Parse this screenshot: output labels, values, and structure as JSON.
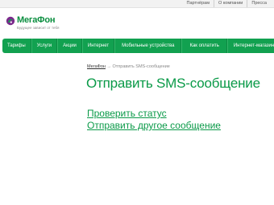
{
  "top_links": [
    "Партнёрам",
    "О компании",
    "Пресса"
  ],
  "logo": {
    "name": "МегаФон",
    "tagline": "Будущее зависит от тебя",
    "brand_green": "#0a8e3f",
    "brand_purple": "#7b2a8c"
  },
  "nav": {
    "color": "#12a150",
    "items": [
      "Тарифы",
      "Услуги",
      "Акции",
      "Интернет",
      "Мобильные устройства",
      "Как оплатить",
      "Интернет-магазин"
    ]
  },
  "breadcrumb": {
    "home": "МегаФон",
    "separator": "→",
    "current": "Отправить SMS-сообщение"
  },
  "page_title": "Отправить SMS-сообщение",
  "links": {
    "check_status": "Проверить статус",
    "send_another": "Отправить другое сообщение"
  }
}
